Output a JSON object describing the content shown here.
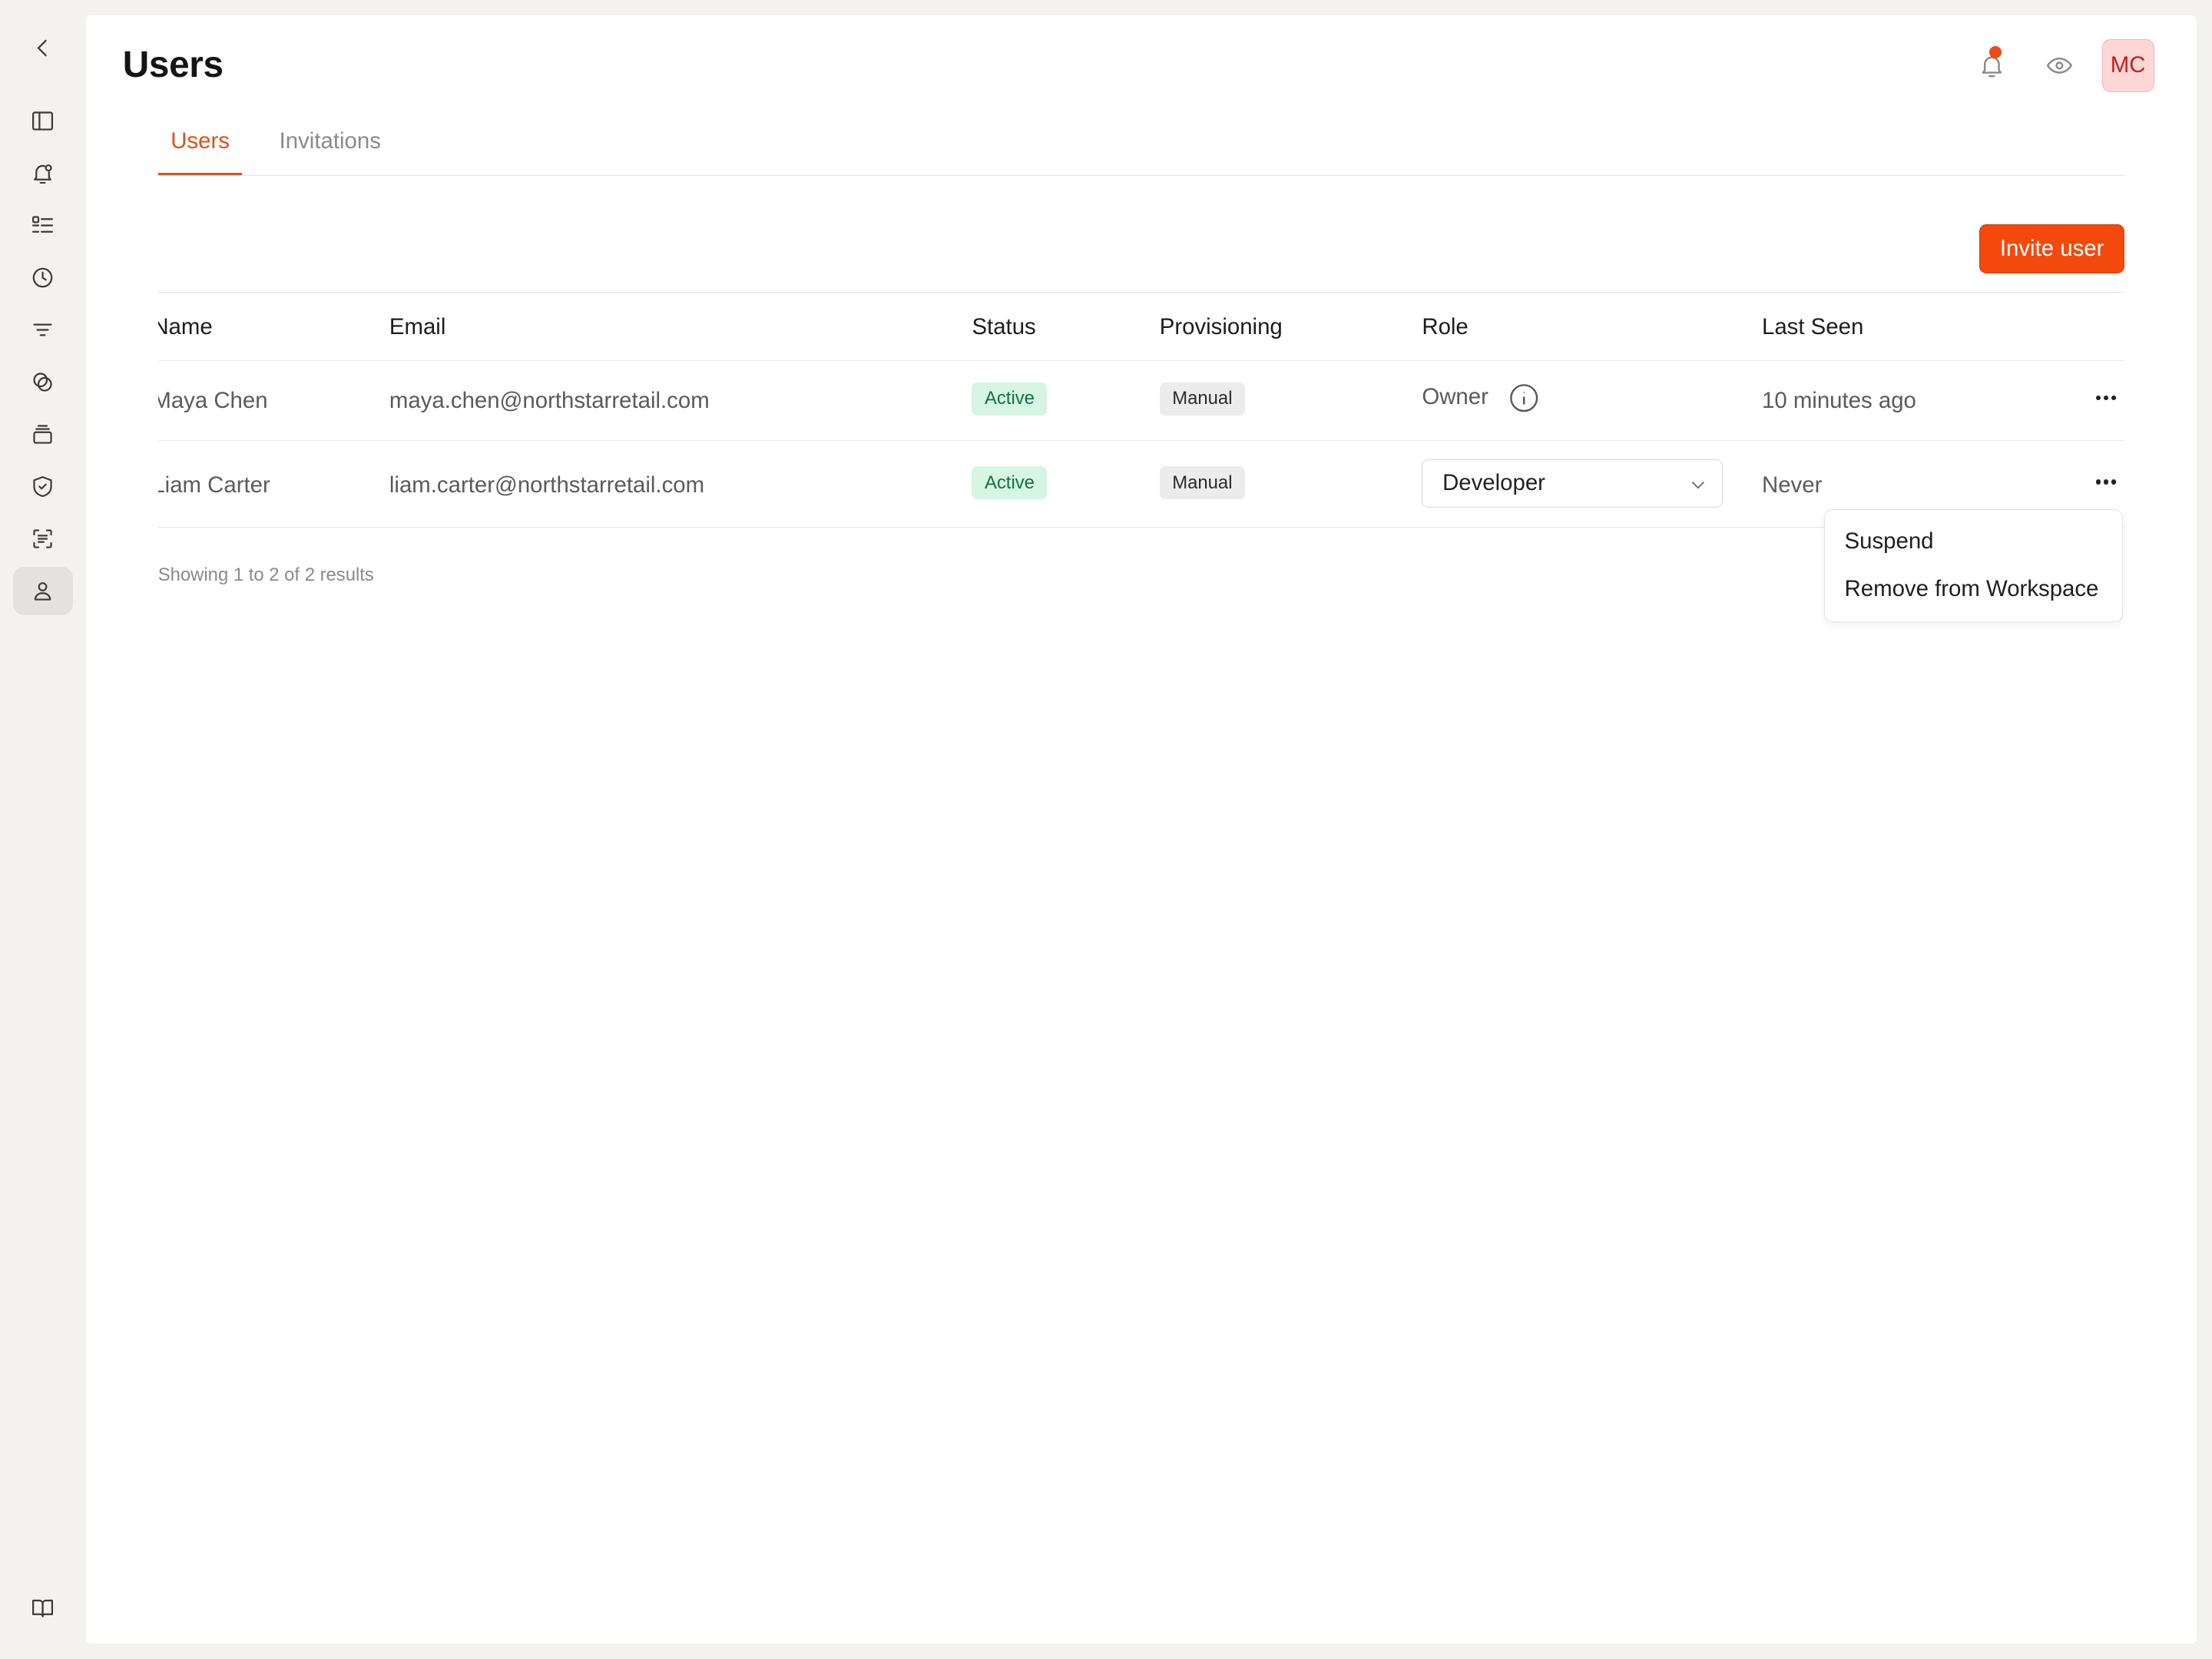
{
  "page": {
    "title": "Users"
  },
  "header": {
    "avatar_initials": "MC",
    "notification_dot_color": "#ec4a14"
  },
  "tabs": [
    {
      "label": "Users",
      "active": true
    },
    {
      "label": "Invitations",
      "active": false
    }
  ],
  "actions": {
    "invite_label": "Invite user"
  },
  "table": {
    "columns": [
      "Name",
      "Email",
      "Status",
      "Provisioning",
      "Role",
      "Last Seen"
    ],
    "rows": [
      {
        "name": "Maya Chen",
        "email": "maya.chen@northstarretail.com",
        "status": "Active",
        "provisioning": "Manual",
        "role": "Owner",
        "last_seen": "10 minutes ago"
      },
      {
        "name": "Liam Carter",
        "email": "liam.carter@northstarretail.com",
        "status": "Active",
        "provisioning": "Manual",
        "role": "Developer",
        "last_seen": "Never"
      }
    ]
  },
  "footer": {
    "results": "Showing 1 to 2 of 2 results"
  },
  "row_menu": {
    "items": [
      "Suspend",
      "Remove from Workspace"
    ]
  },
  "colors": {
    "accent": "#e54d13",
    "button": "#f3490d",
    "active_badge_bg": "#d6f5e3",
    "active_badge_text": "#13713d"
  }
}
